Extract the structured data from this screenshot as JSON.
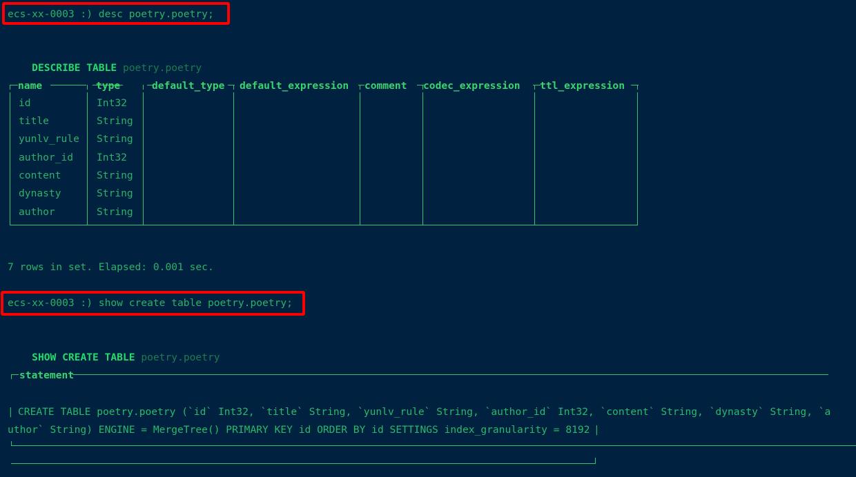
{
  "terminal": {
    "background_color": "#002240",
    "text_color": "#2eb167",
    "keyword_color": "#27d96a",
    "border_color": "#35c46b",
    "highlight_color": "#fe0000"
  },
  "commands": [
    {
      "prompt": "ecs-xx-0003 :)",
      "input": "desc poetry.poetry;",
      "full_line": "ecs-xx-0003 :) desc poetry.poetry;",
      "highlighted": true
    },
    {
      "prompt": "ecs-xx-0003 :)",
      "input": "show create table poetry.poetry;",
      "full_line": "ecs-xx-0003 :) show create table poetry.poetry;",
      "highlighted": true
    }
  ],
  "describe": {
    "echo_keyword": "DESCRIBE TABLE",
    "echo_argument": "poetry.poetry",
    "columns": [
      "name",
      "type",
      "default_type",
      "default_expression",
      "comment",
      "codec_expression",
      "ttl_expression"
    ],
    "rows": [
      {
        "name": "id",
        "type": "Int32",
        "default_type": "",
        "default_expression": "",
        "comment": "",
        "codec_expression": "",
        "ttl_expression": ""
      },
      {
        "name": "title",
        "type": "String",
        "default_type": "",
        "default_expression": "",
        "comment": "",
        "codec_expression": "",
        "ttl_expression": ""
      },
      {
        "name": "yunlv_rule",
        "type": "String",
        "default_type": "",
        "default_expression": "",
        "comment": "",
        "codec_expression": "",
        "ttl_expression": ""
      },
      {
        "name": "author_id",
        "type": "Int32",
        "default_type": "",
        "default_expression": "",
        "comment": "",
        "codec_expression": "",
        "ttl_expression": ""
      },
      {
        "name": "content",
        "type": "String",
        "default_type": "",
        "default_expression": "",
        "comment": "",
        "codec_expression": "",
        "ttl_expression": ""
      },
      {
        "name": "dynasty",
        "type": "String",
        "default_type": "",
        "default_expression": "",
        "comment": "",
        "codec_expression": "",
        "ttl_expression": ""
      },
      {
        "name": "author",
        "type": "String",
        "default_type": "",
        "default_expression": "",
        "comment": "",
        "codec_expression": "",
        "ttl_expression": ""
      }
    ],
    "status": "7 rows in set. Elapsed: 0.001 sec."
  },
  "show_create": {
    "echo_keyword": "SHOW CREATE TABLE",
    "echo_argument": "poetry.poetry",
    "column_header": "statement",
    "statement_line_1": "CREATE TABLE poetry.poetry (`id` Int32, `title` String, `yunlv_rule` String, `author_id` Int32, `content` String, `dynasty` String, `a",
    "statement_line_2": "uthor` String) ENGINE = MergeTree() PRIMARY KEY id ORDER BY id SETTINGS index_granularity = 8192",
    "statement_full": "CREATE TABLE poetry.poetry (`id` Int32, `title` String, `yunlv_rule` String, `author_id` Int32, `content` String, `dynasty` String, `author` String) ENGINE = MergeTree() PRIMARY KEY id ORDER BY id SETTINGS index_granularity = 8192"
  }
}
